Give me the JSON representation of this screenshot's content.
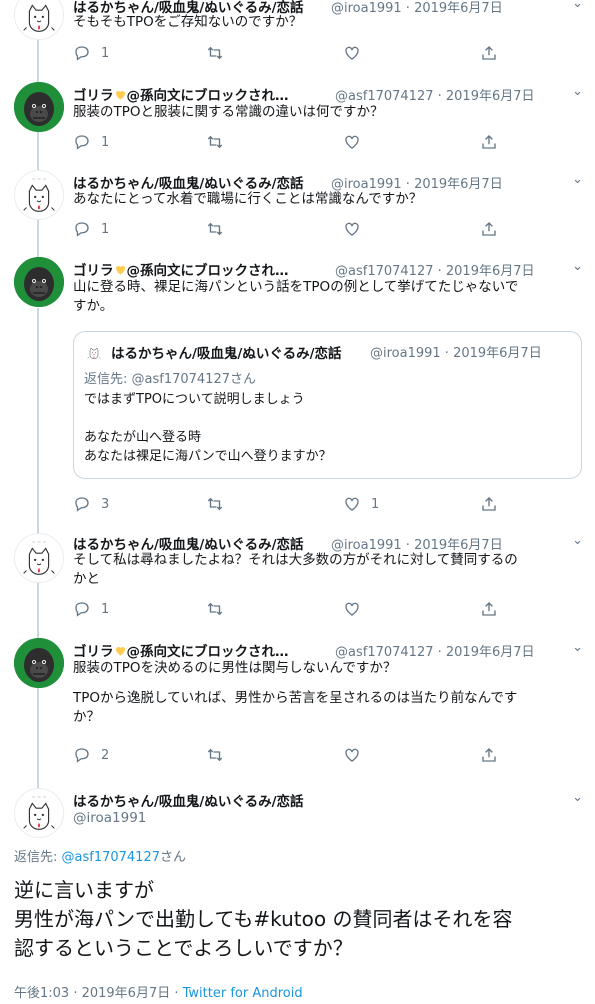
{
  "tweets": [
    {
      "name": "はるかちゃん/吸血鬼/ぬいぐるみ/恋話",
      "handle": "@iroa1991 · 2019年6月7日",
      "text": "そもそもTPOをご存知ないのですか？",
      "reply_count": "1",
      "avatar": "haruka"
    },
    {
      "name_prefix": "ゴリラ",
      "name_suffix": "@孫向文にブロックされ…",
      "handle": "@asf17074127 · 2019年6月7日",
      "text": "服装のTPOと服装に関する常識の違いは何ですか？",
      "reply_count": "1",
      "avatar": "gorilla"
    },
    {
      "name": "はるかちゃん/吸血鬼/ぬいぐるみ/恋話",
      "handle": "@iroa1991 · 2019年6月7日",
      "text": "あなたにとって水着で職場に行くことは常識なんですか？",
      "reply_count": "1",
      "avatar": "haruka"
    },
    {
      "name_prefix": "ゴリラ",
      "name_suffix": "@孫向文にブロックされ…",
      "handle": "@asf17074127 · 2019年6月7日",
      "text_line1": "山に登る時、裸足に海パンという話をTPOの例として挙げてたじゃないで",
      "text_line2": "すか。",
      "reply_count": "3",
      "like_count": "1",
      "avatar": "gorilla",
      "quote": {
        "name": "はるかちゃん/吸血鬼/ぬいぐるみ/恋話",
        "handle": "@iroa1991 · 2019年6月7日",
        "reply_label": "返信先: ",
        "reply_mention": "@asf17074127さん",
        "line1": "ではまずTPOについて説明しましょう",
        "line2": "あなたが山へ登る時",
        "line3": "あなたは裸足に海パンで山へ登りますか？"
      }
    },
    {
      "name": "はるかちゃん/吸血鬼/ぬいぐるみ/恋話",
      "handle": "@iroa1991 · 2019年6月7日",
      "text_line1": "そして私は尋ねましたよね？それは大多数の方がそれに対して賛同するの",
      "text_line2": "かと",
      "reply_count": "1",
      "avatar": "haruka"
    },
    {
      "name_prefix": "ゴリラ",
      "name_suffix": "@孫向文にブロックされ…",
      "handle": "@asf17074127 · 2019年6月7日",
      "text_line1": "服装のTPOを決めるのに男性は関与しないんですか？",
      "text_line2": "TPOから逸脱していれば、男性から苦言を呈されるのは当たり前なんです",
      "text_line3": "か？",
      "reply_count": "2",
      "avatar": "gorilla"
    }
  ],
  "main": {
    "name": "はるかちゃん/吸血鬼/ぬいぐるみ/恋話",
    "handle": "@iroa1991",
    "reply_label": "返信先: ",
    "reply_mention": "@asf17074127",
    "reply_suffix": "さん",
    "line1": "逆に言いますが",
    "line2_a": "男性が海パンで出勤しても",
    "line2_b": "#kutoo",
    "line2_c": " の賛同者はそれを容",
    "line3": "認するということでよろしいですか？",
    "time": "午後1:03 · 2019年6月7日 · ",
    "source": "Twitter for Android"
  },
  "colors": {
    "link": "#1b95e0",
    "muted": "#657786",
    "heart": "#ffcc4d"
  }
}
